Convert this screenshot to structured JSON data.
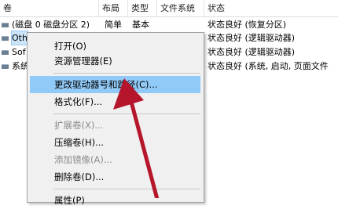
{
  "columns": [
    "卷",
    "布局",
    "类型",
    "文件系统",
    "状态"
  ],
  "volumes": [
    {
      "name": "(磁盘 0 磁盘分区 2)",
      "layout": "简单",
      "type": "基本",
      "fs": "",
      "status": "状态良好 (恢复分区)"
    },
    {
      "name": "Oth",
      "layout": "",
      "type": "",
      "fs": "",
      "status": "状态良好 (逻辑驱动器)"
    },
    {
      "name": "Sof",
      "layout": "",
      "type": "",
      "fs": "",
      "status": "状态良好 (逻辑驱动器)"
    },
    {
      "name": "系统",
      "layout": "",
      "type": "",
      "fs": "",
      "status": "状态良好 (系统, 启动, 页面文件"
    }
  ],
  "context_menu": {
    "open": "打开(O)",
    "explorer": "资源管理器(E)",
    "change_letter": "更改驱动器号和路径(C)...",
    "format": "格式化(F)...",
    "extend": "扩展卷(X)...",
    "shrink": "压缩卷(H)...",
    "add_mirror": "添加镜像(A)...",
    "delete": "删除卷(D)...",
    "properties": "属性(P)"
  },
  "colors": {
    "highlight": "#91c9f7",
    "arrow": "#b5162b"
  }
}
